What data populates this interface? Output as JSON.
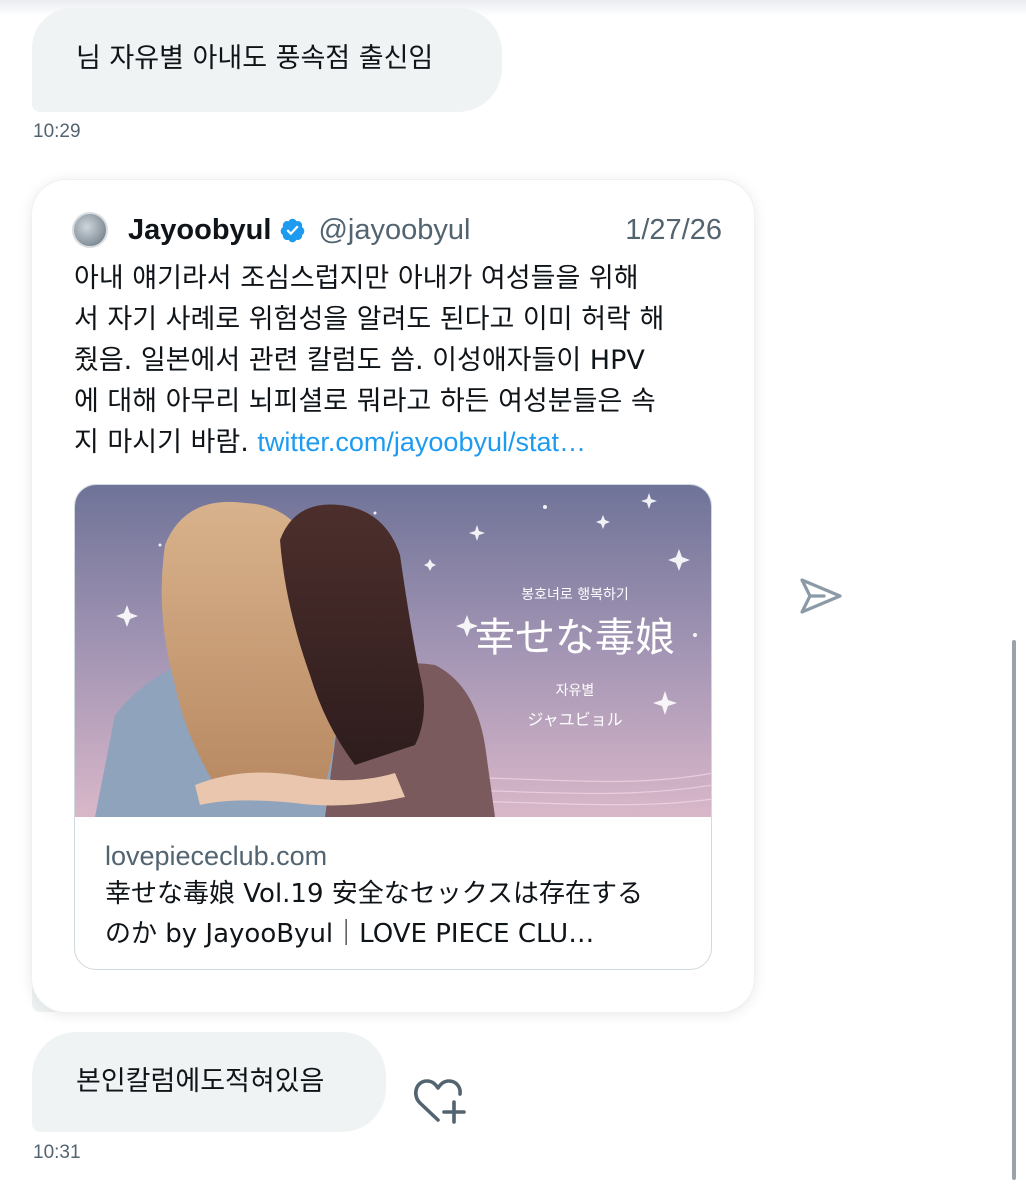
{
  "messages": [
    {
      "text": "님 자유별 아내도 풍속점 출신임",
      "time": "10:29"
    },
    {
      "text": "본인칼럼에도적혀있음",
      "time": "10:31"
    }
  ],
  "quoted_tweet": {
    "author": "Jayoobyul",
    "handle": "@jayoobyul",
    "date": "1/27/26",
    "verified": true,
    "body_lines": [
      "아내 얘기라서 조심스럽지만 아내가 여성들을 위해",
      "서 자기 사례로 위험성을 알려도 된다고 이미 허락 해",
      "줬음. 일본에서 관련 칼럼도 씀. 이성애자들이 HPV",
      "에 대해 아무리 뇌피셜로 뭐라고 하든 여성분들은 속"
    ],
    "body_last_prefix": "지 마시기 바람. ",
    "link": "twitter.com/jayoobyul/stat…",
    "card": {
      "domain": "lovepiececlub.com",
      "title_line1": "幸せな毒娘 Vol.19 安全なセックスは存在する",
      "title_line2": "のか by JayooByul｜LOVE PIECE CLU…",
      "image": {
        "subtitle_kr": "봉호녀로 행복하기",
        "title_jp": "幸せな毒娘",
        "author_kr": "자유별",
        "author_jp": "ジャユビョル"
      }
    }
  },
  "icons": {
    "send": "send-icon",
    "reaction": "add-reaction-icon",
    "verified": "verified-badge-icon"
  },
  "colors": {
    "bubble": "#eff3f4",
    "link": "#1d9bf0",
    "verified": "#1d9bf0",
    "muted": "#536471"
  }
}
